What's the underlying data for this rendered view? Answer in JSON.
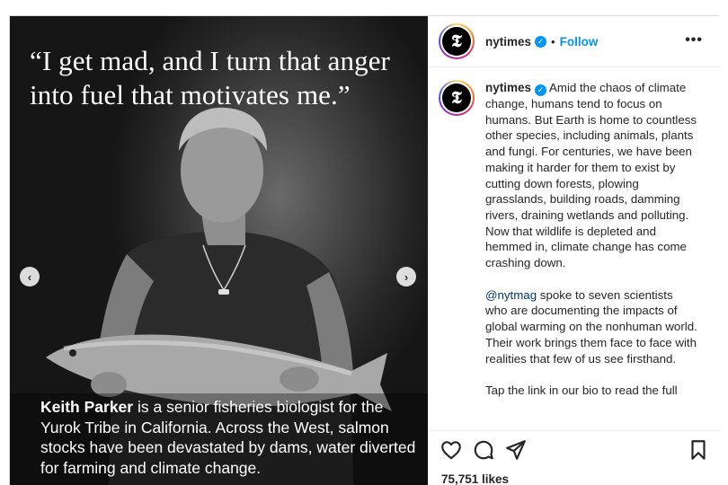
{
  "media": {
    "quote": "“I get mad, and I turn that anger into fuel that motivates me.”",
    "caption_name": "Keith Parker",
    "caption_rest": " is a senior fisheries biologist for the Yurok Tribe in California. Across the West, salmon stocks have been devastated by dams, water diverted for farming and climate change.",
    "prev_icon": "‹",
    "next_icon": "›"
  },
  "header": {
    "avatar_glyph": "𝕿",
    "username": "nytimes",
    "verified_glyph": "✓",
    "dot": "•",
    "follow_label": "Follow",
    "more_label": "•••"
  },
  "post_caption": {
    "username": "nytimes",
    "paragraph1": "Amid the chaos of climate change, humans tend to focus on humans. But Earth is home to countless other species, including animals, plants and fungi. For centuries, we have been making it harder for them to exist by cutting down forests, plowing grasslands, building roads, damming rivers, draining wetlands and polluting. Now that wildlife is depleted and hemmed in, climate change has come crashing down.",
    "mention": "@nytmag",
    "paragraph2_rest": " spoke to seven scientists who are documenting the impacts of global warming on the nonhuman world. Their work brings them face to face with realities that few of us see firsthand.",
    "paragraph3": "Tap the link in our bio to read the full"
  },
  "actions": {
    "likes": "75,751 likes"
  },
  "colors": {
    "accent": "#0095f6",
    "text": "#262626",
    "border": "#dbdbdb"
  }
}
